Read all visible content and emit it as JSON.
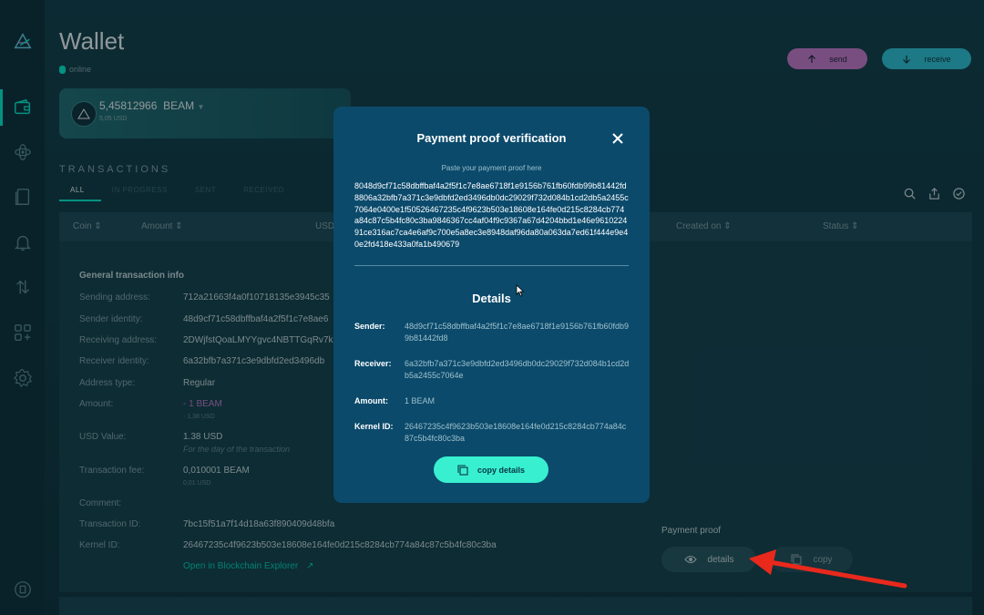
{
  "app": {
    "title": "Wallet",
    "status": "online",
    "send_label": "send",
    "receive_label": "receive"
  },
  "nav": {
    "items": [
      "logo-icon",
      "wallet-icon",
      "atomic-swap-icon",
      "addresses-icon",
      "notifications-icon",
      "transfer-icon",
      "applications-icon",
      "settings-icon",
      "help-icon"
    ]
  },
  "balance": {
    "amount": "5,45812966",
    "unit": "BEAM",
    "usd": "5,05 USD"
  },
  "transactions": {
    "heading": "TRANSACTIONS",
    "tabs": [
      "ALL",
      "IN PROGRESS",
      "SENT",
      "RECEIVED"
    ],
    "columns": [
      "Coin",
      "Amount",
      "USD",
      "Created on",
      "Status"
    ]
  },
  "details": {
    "section_title": "General transaction info",
    "rows": [
      {
        "label": "Sending address:",
        "value": "712a21663f4a0f10718135e3945c35"
      },
      {
        "label": "Sender identity:",
        "value": "48d9cf71c58dbffbaf4a2f5f1c7e8ae6"
      },
      {
        "label": "Receiving address:",
        "value": "2DWjfstQoaLMYYgvc4NBTTGqRv7k"
      },
      {
        "label": "Receiver identity:",
        "value": "6a32bfb7a371c3e9dbfd2ed3496db"
      },
      {
        "label": "Address type:",
        "value": "Regular"
      },
      {
        "label": "Amount:",
        "value": "- 1  BEAM",
        "sub": "- 1,38 USD"
      },
      {
        "label": "USD Value:",
        "value": "1.38 USD",
        "sub": "For the day of the transaction"
      },
      {
        "label": "Transaction fee:",
        "value": "0,010001  BEAM",
        "sub": "0,01 USD"
      },
      {
        "label": "Comment:",
        "value": ""
      },
      {
        "label": "Transaction ID:",
        "value": "7bc15f51a7f14d18a63f890409d48bfa"
      },
      {
        "label": "Kernel ID:",
        "value": "26467235c4f9623b503e18608e164fe0d215c8284cb774a84c87c5b4fc80c3ba"
      }
    ],
    "explorer_link": "Open in Blockchain Explorer",
    "proof_title": "Payment proof",
    "details_button": "details",
    "copy_button": "copy"
  },
  "modal": {
    "title": "Payment proof verification",
    "hint": "Paste your payment proof here",
    "proof": "8048d9cf71c58dbffbaf4a2f5f1c7e8ae6718f1e9156b761fb60fdb99b81442fd8806a32bfb7a371c3e9dbfd2ed3496db0dc29029f732d084b1cd2db5a2455c7064e0400e1f50526467235c4f9623b503e18608e164fe0d215c8284cb774a84c87c5b4fc80c3ba9846367cc4af04f9c9367a67d4204bbd1e46e961022491ce316ac7ca4e6af9c700e5a8ec3e8948daf96da80a063da7ed61f444e9e40e2fd418e433a0fa1b490679",
    "details_heading": "Details",
    "sender_label": "Sender:",
    "sender": "48d9cf71c58dbffbaf4a2f5f1c7e8ae6718f1e9156b761fb60fdb99b81442fd8",
    "receiver_label": "Receiver:",
    "receiver": "6a32bfb7a371c3e9dbfd2ed3496db0dc29029f732d084b1cd2db5a2455c7064e",
    "amount_label": "Amount:",
    "amount": "1 BEAM",
    "kernel_label": "Kernel ID:",
    "kernel": "26467235c4f9623b503e18608e164fe0d215c8284cb774a84c87c5b4fc80c3ba",
    "copy_label": "copy details"
  },
  "colors": {
    "accent": "#00f6d2",
    "send": "#d47bd0",
    "receive": "#2cc9d9",
    "modal_bg": "#0b4a6b",
    "annotation_arrow": "#e8291c"
  }
}
